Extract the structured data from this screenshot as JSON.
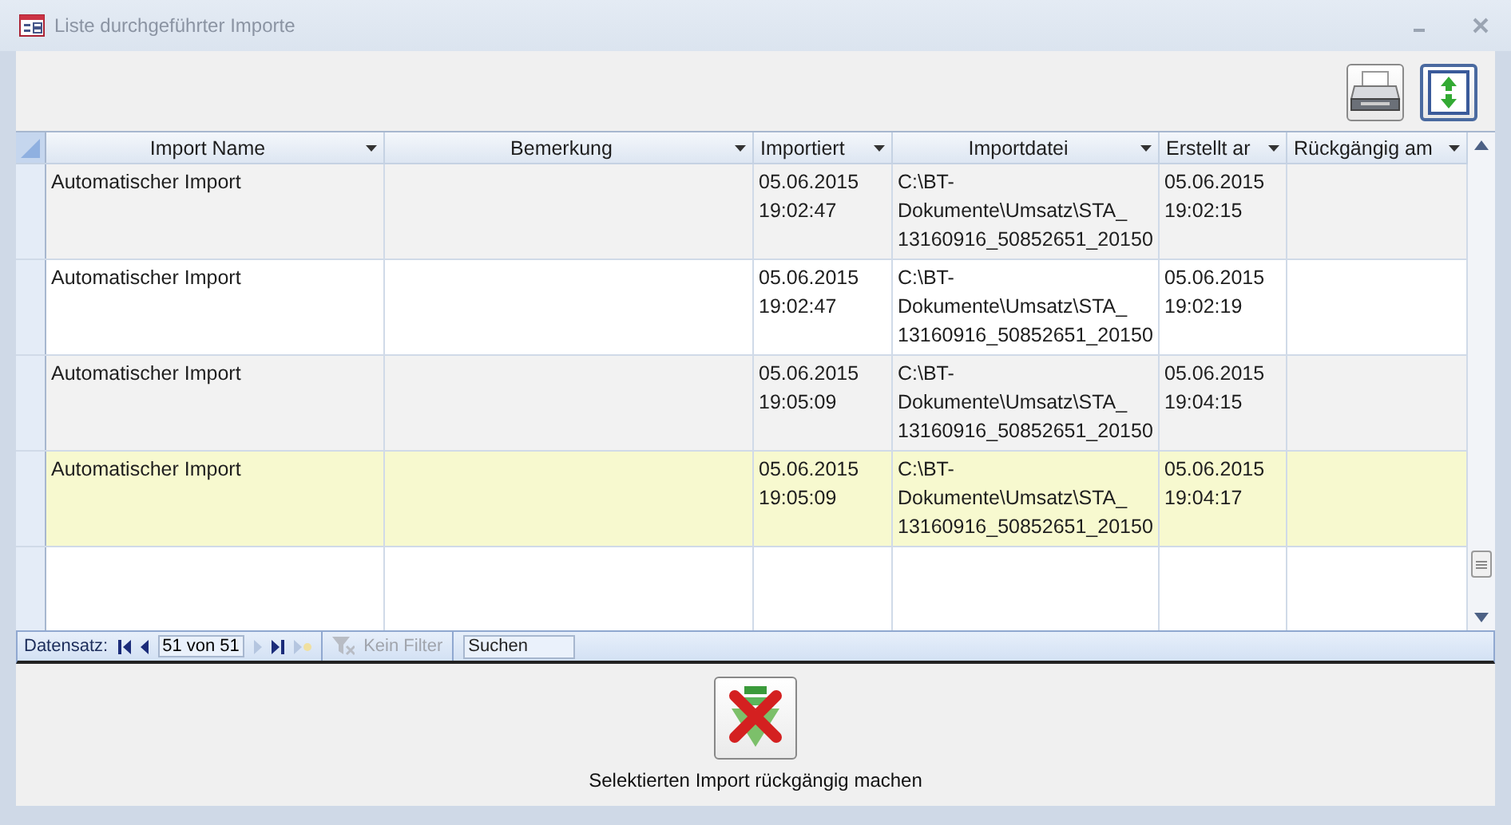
{
  "window": {
    "title": "Liste durchgeführter Importe"
  },
  "table": {
    "columns": [
      {
        "label": "Import Name"
      },
      {
        "label": "Bemerkung"
      },
      {
        "label": "Importiert"
      },
      {
        "label": "Importdatei"
      },
      {
        "label": "Erstellt ar"
      },
      {
        "label": "Rückgängig am"
      }
    ],
    "rows": [
      {
        "selected": false,
        "cells": [
          "Automatischer Import",
          "",
          "05.06.2015\n19:02:47",
          "C:\\BT-\nDokumente\\Umsatz\\STA_\n13160916_50852651_20150",
          "05.06.2015\n19:02:15",
          ""
        ]
      },
      {
        "selected": false,
        "cells": [
          "Automatischer Import",
          "",
          "05.06.2015\n19:02:47",
          "C:\\BT-\nDokumente\\Umsatz\\STA_\n13160916_50852651_20150",
          "05.06.2015\n19:02:19",
          ""
        ]
      },
      {
        "selected": false,
        "cells": [
          "Automatischer Import",
          "",
          "05.06.2015\n19:05:09",
          "C:\\BT-\nDokumente\\Umsatz\\STA_\n13160916_50852651_20150",
          "05.06.2015\n19:04:15",
          ""
        ]
      },
      {
        "selected": true,
        "cells": [
          "Automatischer Import",
          "",
          "05.06.2015\n19:05:09",
          "C:\\BT-\nDokumente\\Umsatz\\STA_\n13160916_50852651_20150",
          "05.06.2015\n19:04:17",
          ""
        ]
      }
    ]
  },
  "navigation": {
    "label": "Datensatz:",
    "record": "51 von 51",
    "filter": "Kein Filter",
    "search_placeholder": "Suchen"
  },
  "undo_button": {
    "label": "Selektierten Import rückgängig machen"
  }
}
